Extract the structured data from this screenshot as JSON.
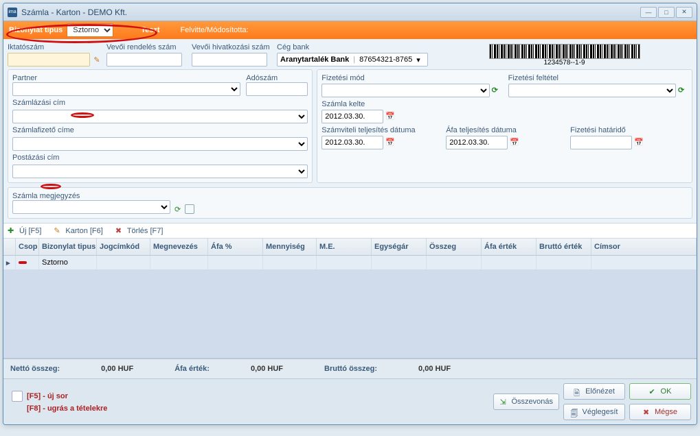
{
  "window": {
    "title": "Számla - Karton  - DEMO Kft."
  },
  "orangebar": {
    "bizonylat_label": "Bizonylat tipus",
    "bizonylat_value": "Sztorno",
    "teszt": "Teszt",
    "felvitte": "Felvitte/Módosította:"
  },
  "top": {
    "iktatoszam_label": "Iktatószám",
    "iktatoszam_value": "",
    "vevoi_rendeles_label": "Vevői rendelés szám",
    "vevoi_rendeles_value": "",
    "vevoi_hivatkozasi_label": "Vevői hivatkozási szám",
    "vevoi_hivatkozasi_value": "",
    "ceg_bank_label": "Cég bank",
    "bank_name": "Aranytartalék Bank",
    "bank_account": "87654321-8765",
    "barcode_text": "1234578--1-9"
  },
  "left": {
    "partner_label": "Partner",
    "adoszam_label": "Adószám",
    "szamlazasi_cim_label": "Számlázási cím",
    "szamlafizeto_label": "Számlafizető címe",
    "postazasi_cim_label": "Postázási  cím"
  },
  "right": {
    "fizetesi_mod_label": "Fizetési mód",
    "fizetesi_feltetel_label": "Fizetési feltétel",
    "szamla_kelte_label": "Számla kelte",
    "szamla_kelte_value": "2012.03.30.",
    "szamviteli_label": "Számviteli teljesítés dátuma",
    "szamviteli_value": "2012.03.30.",
    "afa_telj_label": "Áfa teljesítés dátuma",
    "afa_telj_value": "2012.03.30.",
    "fizetesi_hatarido_label": "Fizetési határidő",
    "fizetesi_hatarido_value": ""
  },
  "note": {
    "label": "Számla megjegyzés"
  },
  "toolbar": {
    "uj": "Új  [F5]",
    "karton": "Karton  [F6]",
    "torles": "Törlés  [F7]"
  },
  "grid": {
    "headers": [
      "",
      "Csop",
      "Bizonylat tipus",
      "Jogcímkód",
      "Megnevezés",
      "Áfa %",
      "Mennyiség",
      "M.E.",
      "Egységár",
      "Összeg",
      "Áfa érték",
      "Bruttó érték",
      "Címsor"
    ],
    "row1_bizonylat": "Sztorno"
  },
  "totals": {
    "netto_label": "Nettó összeg:",
    "netto_val": "0,00 HUF",
    "afa_label": "Áfa érték:",
    "afa_val": "0,00 HUF",
    "brutto_label": "Bruttó összeg:",
    "brutto_val": "0,00 HUF"
  },
  "footer": {
    "hint_f5": "[F5] - új sor",
    "hint_f8": "[F8] - ugrás a tételekre",
    "osszevonas": "Összevonás",
    "elonezet": "Előnézet",
    "veglegesit": "Véglegesít",
    "ok": "OK",
    "megse": "Mégse"
  }
}
